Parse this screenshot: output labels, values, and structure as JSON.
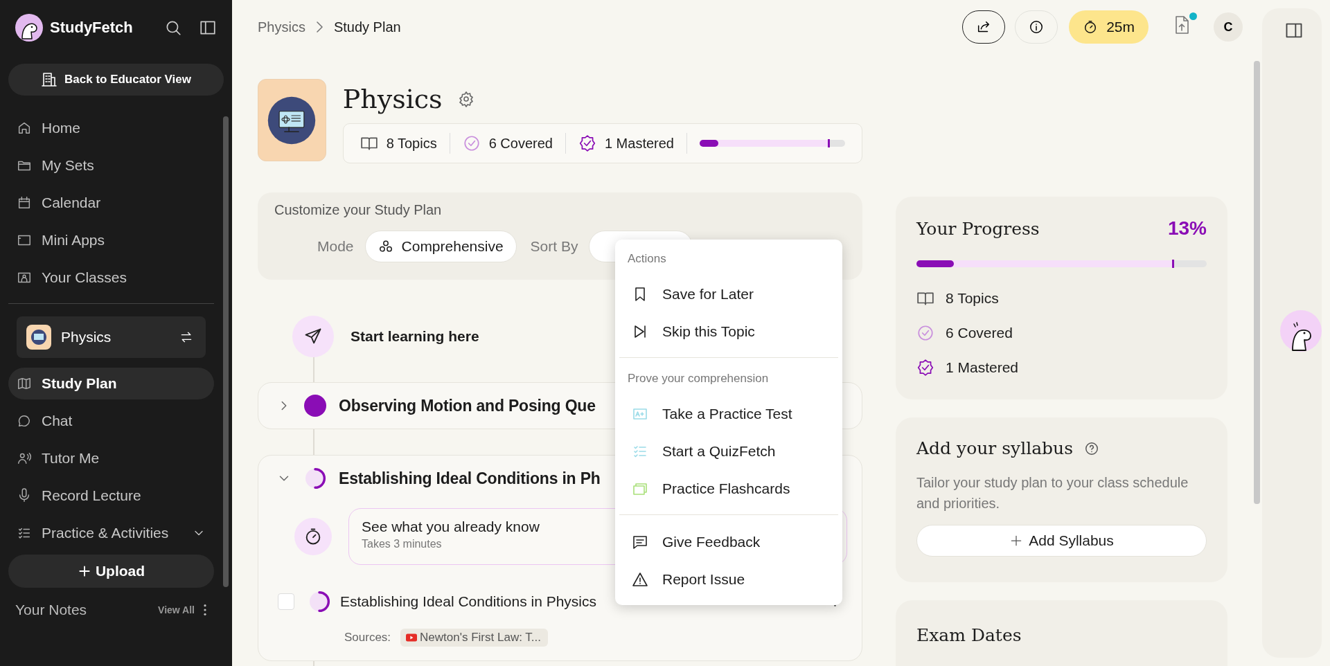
{
  "sidebar": {
    "brand": "StudyFetch",
    "back_button": "Back to Educator View",
    "nav_items": [
      {
        "label": "Home",
        "selected": false
      },
      {
        "label": "My Sets",
        "selected": false
      },
      {
        "label": "Calendar",
        "selected": false
      },
      {
        "label": "Mini Apps",
        "selected": false
      },
      {
        "label": "Your Classes",
        "selected": false
      }
    ],
    "class_switcher": {
      "label": "Physics"
    },
    "class_nav": [
      {
        "label": "Study Plan",
        "selected": true
      },
      {
        "label": "Chat",
        "selected": false
      },
      {
        "label": "Tutor Me",
        "selected": false
      },
      {
        "label": "Record Lecture",
        "selected": false
      },
      {
        "label": "Practice & Activities",
        "selected": false
      }
    ],
    "upload_button": "Upload",
    "notes": {
      "title": "Your Notes",
      "view_all": "View All"
    }
  },
  "breadcrumb": [
    "Physics",
    "Study Plan"
  ],
  "toolbar": {
    "timer": "25m",
    "avatar": "C",
    "upload_notification": true
  },
  "course": {
    "title": "Physics",
    "stats": [
      {
        "kind": "topics",
        "label": "8 Topics"
      },
      {
        "kind": "covered",
        "label": "6 Covered"
      },
      {
        "kind": "mastered",
        "label": "1 Mastered"
      }
    ],
    "progress": {
      "level": 0.13
    },
    "goal_marker": {
      "level": 0.88
    }
  },
  "customize": {
    "title": "Customize your Study Plan",
    "mode_label": "Mode",
    "mode_value": "Comprehensive",
    "sort_label": "Sort By"
  },
  "timeline": {
    "start_label": "Start learning here",
    "topics": [
      {
        "title": "Observing Motion and Posing Que",
        "expanded": false,
        "kind": "complete"
      },
      {
        "title": "Establishing Ideal Conditions in Ph",
        "expanded": true,
        "kind": "partial",
        "quiz": {
          "title": "See what you already know",
          "subtitle": "Takes 3 minutes"
        },
        "subtopics": [
          {
            "title": "Establishing Ideal Conditions in Physics",
            "checked": false,
            "kind": "partial",
            "sources_label": "Sources:",
            "sources": [
              "Newton's First Law: T..."
            ]
          }
        ]
      }
    ]
  },
  "menu": {
    "sections": [
      {
        "title": "Actions",
        "items": [
          "Save for Later",
          "Skip this Topic"
        ]
      },
      {
        "title": "Prove your comprehension",
        "items": [
          "Take a Practice Test",
          "Start a QuizFetch",
          "Practice Flashcards"
        ]
      },
      {
        "items": [
          "Give Feedback",
          "Report Issue"
        ]
      }
    ]
  },
  "progress_card": {
    "title": "Your Progress",
    "percent": "13%",
    "progress": {
      "level": 0.13
    },
    "goal_marker": {
      "level": 0.88
    },
    "stats": [
      {
        "kind": "topics",
        "label": "8 Topics"
      },
      {
        "kind": "covered",
        "label": "6 Covered"
      },
      {
        "kind": "mastered",
        "label": "1 Mastered"
      }
    ]
  },
  "syllabus": {
    "title": "Add your syllabus",
    "description": "Tailor your study plan to your class schedule and priorities.",
    "button": "Add Syllabus"
  },
  "exam": {
    "title": "Exam Dates"
  }
}
